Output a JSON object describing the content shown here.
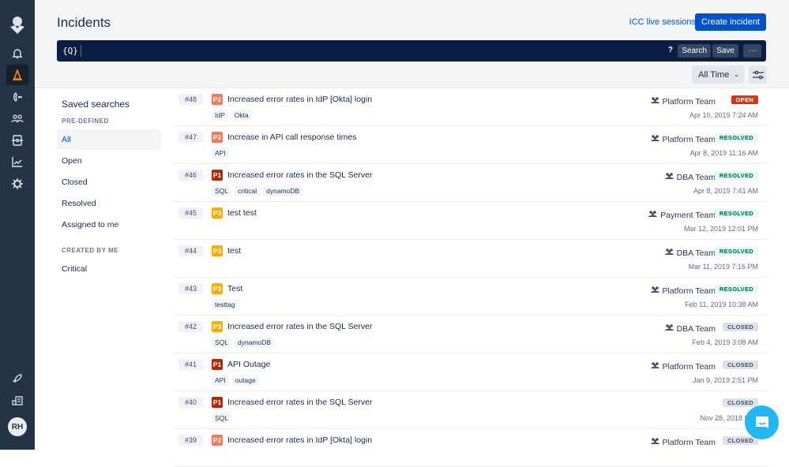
{
  "header": {
    "title": "Incidents",
    "icc_link": "ICC live sessions",
    "create_button": "Create incident"
  },
  "search": {
    "query_icon_label": "{Q}",
    "help": "?",
    "search_button": "Search",
    "save_button": "Save",
    "more_button": "···"
  },
  "filters": {
    "time_range": "All Time"
  },
  "user": {
    "initials": "RH"
  },
  "saved_searches": {
    "title": "Saved searches",
    "predefined_label": "PRE-DEFINED",
    "predefined": [
      "All",
      "Open",
      "Closed",
      "Resolved",
      "Assigned to me"
    ],
    "created_label": "CREATED BY ME",
    "created": [
      "Critical"
    ]
  },
  "colors": {
    "P1": "#bf2600",
    "P2": "#ff7452",
    "P3": "#ffab00",
    "OPEN": "#de350b",
    "RESOLVED": "#e3fcef",
    "CLOSED": "#dfe1e6"
  },
  "incidents": [
    {
      "id": "#48",
      "priority": "P2",
      "title": "Increased error rates in IdP [Okta] login",
      "tags": [
        "IdP",
        "Okta"
      ],
      "team": "Platform Team",
      "status": "OPEN",
      "date": "Apr 10, 2019 7:24 AM"
    },
    {
      "id": "#47",
      "priority": "P2",
      "title": "Increase in API call response times",
      "tags": [
        "API"
      ],
      "team": "Platform Team",
      "status": "RESOLVED",
      "date": "Apr 8, 2019 11:16 AM"
    },
    {
      "id": "#46",
      "priority": "P1",
      "title": "Increased error rates in the SQL Server",
      "tags": [
        "SQL",
        "critical",
        "dynamoDB"
      ],
      "team": "DBA Team",
      "status": "RESOLVED",
      "date": "Apr 8, 2019 7:41 AM"
    },
    {
      "id": "#45",
      "priority": "P3",
      "title": "test test",
      "tags": [],
      "team": "Payment Team",
      "status": "RESOLVED",
      "date": "Mar 12, 2019 12:01 PM"
    },
    {
      "id": "#44",
      "priority": "P3",
      "title": "test",
      "tags": [],
      "team": "DBA Team",
      "status": "RESOLVED",
      "date": "Mar 11, 2019 7:16 PM"
    },
    {
      "id": "#43",
      "priority": "P3",
      "title": "Test",
      "tags": [
        "testtag"
      ],
      "team": "Platform Team",
      "status": "RESOLVED",
      "date": "Feb 11, 2019 10:38 AM"
    },
    {
      "id": "#42",
      "priority": "P3",
      "title": "Increased error rates in the SQL Server",
      "tags": [
        "SQL",
        "dynamoDB"
      ],
      "team": "DBA Team",
      "status": "CLOSED",
      "date": "Feb 4, 2019 3:08 AM"
    },
    {
      "id": "#41",
      "priority": "P1",
      "title": "API Outage",
      "tags": [
        "API",
        "outage"
      ],
      "team": "Platform Team",
      "status": "CLOSED",
      "date": "Jan 9, 2019 2:51 PM"
    },
    {
      "id": "#40",
      "priority": "P1",
      "title": "Increased error rates in the SQL Server",
      "tags": [
        "SQL"
      ],
      "team": "",
      "status": "CLOSED",
      "date": "Nov 28, 2018 9:13"
    },
    {
      "id": "#39",
      "priority": "P2",
      "title": "Increased error rates in IdP [Okta] login",
      "tags": [],
      "team": "Platform Team",
      "status": "CLOSED",
      "date": ""
    }
  ]
}
